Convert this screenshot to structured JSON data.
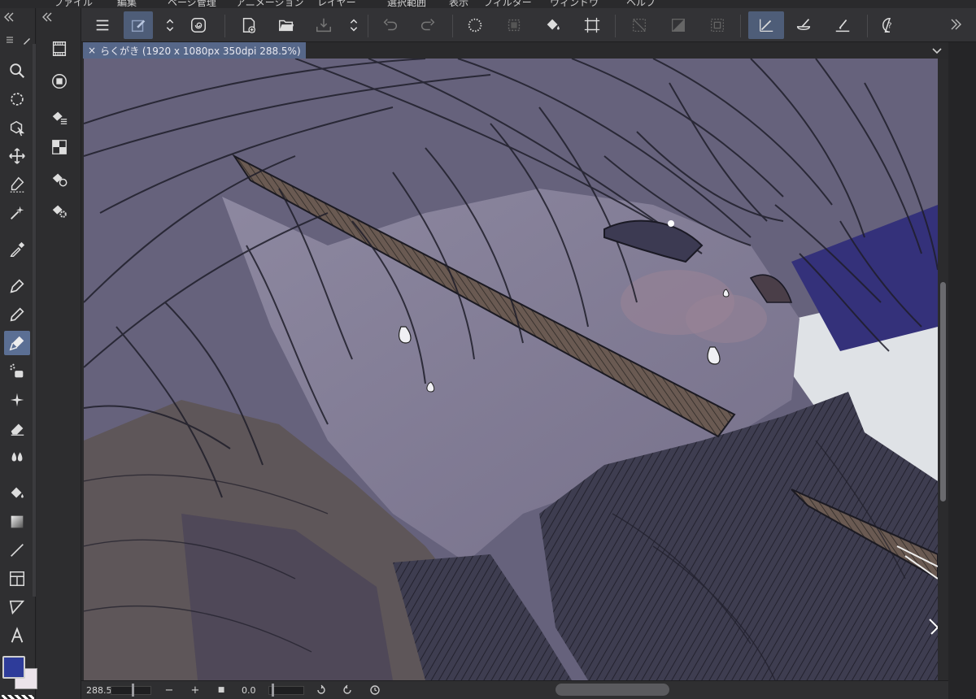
{
  "menu": {
    "items": [
      "ファイル",
      "編集",
      "ページ管理",
      "アニメーション",
      "レイヤー",
      "選択範囲",
      "表示",
      "フィルター",
      "ウィンドウ",
      "ヘルプ"
    ]
  },
  "document_tab": {
    "close_glyph": "×",
    "title": "らくがき (1920 x 1080px 350dpi 288.5%)"
  },
  "status": {
    "zoom": "288.5",
    "angle": "0.0",
    "zoom_out_glyph": "−",
    "zoom_in_glyph": "+",
    "stop_glyph": "■"
  },
  "colors": {
    "main_color": "#2e3c9a",
    "sub_color": "#ebe3ea",
    "accent_active": "#5b6f94",
    "tab_active": "#566789"
  },
  "command_bar_icons": [
    "menu-icon",
    "edit-icon",
    "updown-icon",
    "spiral-icon",
    "new-canvas-icon",
    "open-folder-icon",
    "save-icon",
    "undo-icon",
    "redo-icon",
    "clear-icon",
    "select-all-icon",
    "fill-icon",
    "transform-icon",
    "deselect-icon",
    "invert-selection-icon",
    "show-selection-icon",
    "snap-ruler-icon",
    "snap-grid-icon",
    "snap-special-ruler-icon",
    "help-icon"
  ],
  "tool_icons": [
    "zoom-icon",
    "rotate-icon",
    "object-icon",
    "move-icon",
    "lasso-icon",
    "magic-wand-icon",
    "eyedropper-icon",
    "pen-icon",
    "pencil-icon",
    "brush-icon",
    "airbrush-icon",
    "decoration-icon",
    "eraser-icon",
    "blend-icon",
    "fill-tool-icon",
    "gradient-icon",
    "line-icon",
    "frame-icon",
    "ruler-icon",
    "text-icon"
  ],
  "subtool_icons": [
    "animation-icon",
    "record-icon",
    "layer-property-icon",
    "navigator-icon",
    "sub-view-icon",
    "settings-icon"
  ]
}
